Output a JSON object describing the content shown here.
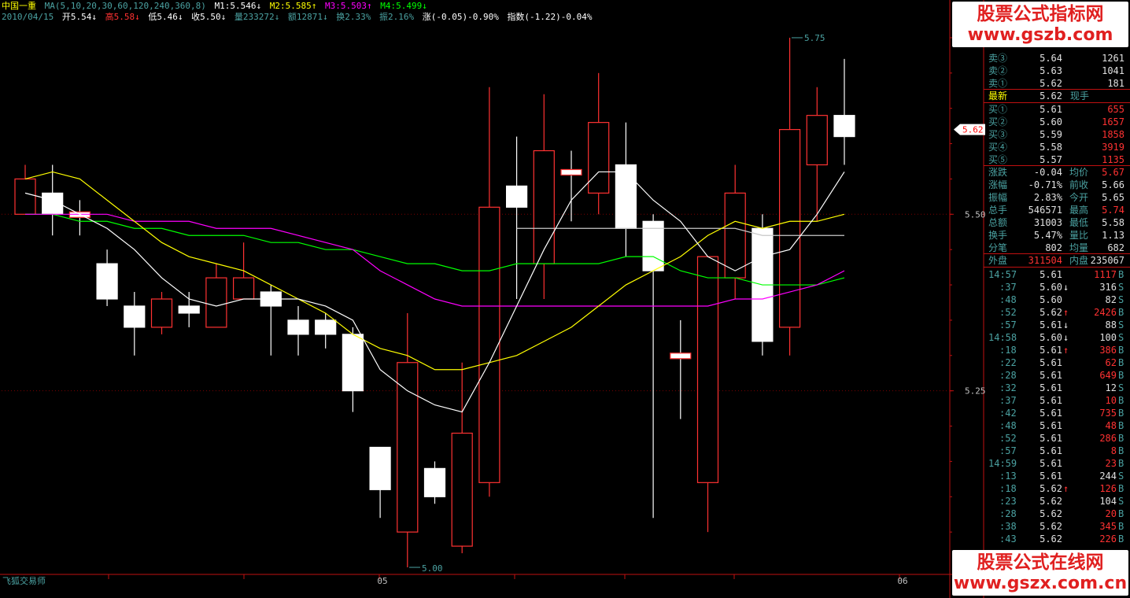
{
  "header": {
    "stock_name": "中国一重",
    "ma_label": "MA(5,10,20,30,60,120,240,360,8)",
    "m1": "M1:5.546↓",
    "m2": "M2:5.585↑",
    "m3": "M3:5.503↑",
    "m4": "M4:5.499↓",
    "date": "2010/04/15",
    "open": "开5.54↓",
    "high": "高5.58↓",
    "low": "低5.46↓",
    "close": "收5.50↓",
    "volume": "量233272↓",
    "amount": "额12871↓",
    "turnover": "换2.33%",
    "amplitude": "振2.16%",
    "change": "涨(-0.05)-0.90%",
    "index": "指数(-1.22)-0.04%"
  },
  "axis": {
    "price_labels": [
      "5.50",
      "5.25"
    ],
    "current_price_tag": "5.62",
    "max_label": "5.75",
    "min_label": "5.00",
    "month_labels": [
      "05",
      "06"
    ]
  },
  "colors": {
    "up": "#ff3232",
    "down": "#ffffff",
    "ma5": "#ffffff",
    "ma10": "#ffff00",
    "ma20": "#ff00ff",
    "ma30": "#00ff00",
    "ma60": "#c8c8c8",
    "axis": "#c01010",
    "label": "#4ba2a2"
  },
  "chart_data": {
    "type": "candlestick",
    "candles": [
      {
        "o": 5.5,
        "c": 5.55,
        "h": 5.57,
        "l": 5.5
      },
      {
        "o": 5.53,
        "c": 5.5,
        "h": 5.57,
        "l": 5.47
      },
      {
        "o": 5.5,
        "c": 5.5,
        "h": 5.52,
        "l": 5.47
      },
      {
        "o": 5.43,
        "c": 5.38,
        "h": 5.45,
        "l": 5.37
      },
      {
        "o": 5.37,
        "c": 5.34,
        "h": 5.39,
        "l": 5.3
      },
      {
        "o": 5.34,
        "c": 5.38,
        "h": 5.39,
        "l": 5.33
      },
      {
        "o": 5.37,
        "c": 5.36,
        "h": 5.39,
        "l": 5.34
      },
      {
        "o": 5.34,
        "c": 5.41,
        "h": 5.43,
        "l": 5.34
      },
      {
        "o": 5.38,
        "c": 5.41,
        "h": 5.46,
        "l": 5.38
      },
      {
        "o": 5.39,
        "c": 5.37,
        "h": 5.4,
        "l": 5.3
      },
      {
        "o": 5.35,
        "c": 5.33,
        "h": 5.37,
        "l": 5.3
      },
      {
        "o": 5.35,
        "c": 5.33,
        "h": 5.36,
        "l": 5.31
      },
      {
        "o": 5.33,
        "c": 5.25,
        "h": 5.34,
        "l": 5.22
      },
      {
        "o": 5.17,
        "c": 5.11,
        "h": 5.17,
        "l": 5.07
      },
      {
        "o": 5.05,
        "c": 5.29,
        "h": 5.36,
        "l": 5.0
      },
      {
        "o": 5.14,
        "c": 5.1,
        "h": 5.15,
        "l": 5.09
      },
      {
        "o": 5.03,
        "c": 5.19,
        "h": 5.29,
        "l": 5.02
      },
      {
        "o": 5.12,
        "c": 5.51,
        "h": 5.68,
        "l": 5.1
      },
      {
        "o": 5.54,
        "c": 5.51,
        "h": 5.61,
        "l": 5.38
      },
      {
        "o": 5.43,
        "c": 5.59,
        "h": 5.67,
        "l": 5.38
      },
      {
        "o": 5.56,
        "c": 5.56,
        "h": 5.59,
        "l": 5.49
      },
      {
        "o": 5.53,
        "c": 5.63,
        "h": 5.7,
        "l": 5.5
      },
      {
        "o": 5.57,
        "c": 5.48,
        "h": 5.63,
        "l": 5.44
      },
      {
        "o": 5.49,
        "c": 5.42,
        "h": 5.5,
        "l": 5.07
      },
      {
        "o": 5.3,
        "c": 5.3,
        "h": 5.35,
        "l": 5.21
      },
      {
        "o": 5.12,
        "c": 5.44,
        "h": 5.44,
        "l": 5.05
      },
      {
        "o": 5.41,
        "c": 5.53,
        "h": 5.57,
        "l": 5.38
      },
      {
        "o": 5.48,
        "c": 5.32,
        "h": 5.5,
        "l": 5.3
      },
      {
        "o": 5.34,
        "c": 5.62,
        "h": 5.75,
        "l": 5.3
      },
      {
        "o": 5.57,
        "c": 5.64,
        "h": 5.68,
        "l": 5.49
      },
      {
        "o": 5.64,
        "c": 5.61,
        "h": 5.72,
        "l": 5.57
      }
    ],
    "ma5": [
      5.53,
      5.52,
      5.5,
      5.48,
      5.45,
      5.41,
      5.38,
      5.37,
      5.38,
      5.38,
      5.38,
      5.37,
      5.35,
      5.28,
      5.25,
      5.23,
      5.22,
      5.29,
      5.37,
      5.45,
      5.52,
      5.56,
      5.56,
      5.52,
      5.49,
      5.44,
      5.42,
      5.44,
      5.45,
      5.5,
      5.56
    ],
    "ma10": [
      5.55,
      5.56,
      5.55,
      5.52,
      5.49,
      5.46,
      5.44,
      5.43,
      5.42,
      5.4,
      5.38,
      5.36,
      5.33,
      5.31,
      5.3,
      5.28,
      5.28,
      5.29,
      5.3,
      5.32,
      5.34,
      5.37,
      5.4,
      5.42,
      5.44,
      5.47,
      5.49,
      5.48,
      5.49,
      5.49,
      5.5
    ],
    "ma20": [
      5.5,
      5.5,
      5.5,
      5.5,
      5.49,
      5.49,
      5.49,
      5.48,
      5.48,
      5.48,
      5.47,
      5.46,
      5.45,
      5.42,
      5.4,
      5.38,
      5.37,
      5.37,
      5.37,
      5.37,
      5.37,
      5.37,
      5.37,
      5.37,
      5.37,
      5.37,
      5.38,
      5.38,
      5.39,
      5.4,
      5.42
    ],
    "ma30": [
      5.5,
      5.5,
      5.49,
      5.49,
      5.48,
      5.48,
      5.47,
      5.47,
      5.47,
      5.46,
      5.46,
      5.45,
      5.45,
      5.44,
      5.43,
      5.43,
      5.42,
      5.42,
      5.43,
      5.43,
      5.43,
      5.43,
      5.44,
      5.44,
      5.42,
      5.41,
      5.41,
      5.4,
      5.4,
      5.4,
      5.41
    ],
    "ma60": [
      null,
      null,
      null,
      null,
      null,
      null,
      null,
      null,
      null,
      null,
      null,
      null,
      null,
      null,
      null,
      null,
      null,
      null,
      5.48,
      5.48,
      5.48,
      5.48,
      5.48,
      5.48,
      5.48,
      5.48,
      5.48,
      5.47,
      5.47,
      5.47,
      5.47
    ],
    "ylim": [
      4.99,
      5.77
    ]
  },
  "quote": {
    "asks": [
      {
        "label": "卖③",
        "price": "5.64",
        "vol": "1261"
      },
      {
        "label": "卖②",
        "price": "5.63",
        "vol": "1041"
      },
      {
        "label": "卖①",
        "price": "5.62",
        "vol": "181"
      }
    ],
    "latest_label": "最新",
    "latest_price": "5.62",
    "latest_tag": "现手",
    "bids": [
      {
        "label": "买①",
        "price": "5.61",
        "vol": "655"
      },
      {
        "label": "买②",
        "price": "5.60",
        "vol": "1657"
      },
      {
        "label": "买③",
        "price": "5.59",
        "vol": "1858"
      },
      {
        "label": "买④",
        "price": "5.58",
        "vol": "3919"
      },
      {
        "label": "买⑤",
        "price": "5.57",
        "vol": "1135"
      }
    ],
    "stats": [
      {
        "k1": "涨跌",
        "v1": "-0.04",
        "k2": "均价",
        "v2": "5.67",
        "c2": "#ff3232"
      },
      {
        "k1": "涨幅",
        "v1": "-0.71%",
        "k2": "前收",
        "v2": "5.66",
        "c2": "#e0e0e0"
      },
      {
        "k1": "振幅",
        "v1": "2.83%",
        "k2": "今开",
        "v2": "5.65",
        "c2": "#e0e0e0"
      },
      {
        "k1": "总手",
        "v1": "546571",
        "k2": "最高",
        "v2": "5.74",
        "c2": "#ff3232"
      },
      {
        "k1": "总额",
        "v1": "31003",
        "k2": "最低",
        "v2": "5.58",
        "c2": "#e0e0e0"
      },
      {
        "k1": "换手",
        "v1": "5.47%",
        "k2": "量比",
        "v2": "1.13",
        "c2": "#e0e0e0"
      },
      {
        "k1": "分笔",
        "v1": "802",
        "k2": "均量",
        "v2": "682",
        "c2": "#e0e0e0"
      }
    ],
    "outer_label": "外盘",
    "outer_val": "311504",
    "inner_label": "内盘",
    "inner_val": "235067"
  },
  "ticks": [
    {
      "t": "14:57",
      "p": "5.61",
      "a": "",
      "v": "1117",
      "vc": "#ff3232",
      "s": "B"
    },
    {
      "t": ":37",
      "p": "5.60",
      "a": "↓",
      "v": "316",
      "vc": "#e0e0e0",
      "s": "S"
    },
    {
      "t": ":48",
      "p": "5.60",
      "a": "",
      "v": "82",
      "vc": "#e0e0e0",
      "s": "S"
    },
    {
      "t": ":52",
      "p": "5.62",
      "a": "↑",
      "v": "2426",
      "vc": "#ff3232",
      "s": "B"
    },
    {
      "t": ":57",
      "p": "5.61",
      "a": "↓",
      "v": "88",
      "vc": "#e0e0e0",
      "s": "S"
    },
    {
      "t": "14:58",
      "p": "5.60",
      "a": "↓",
      "v": "100",
      "vc": "#e0e0e0",
      "s": "S"
    },
    {
      "t": ":18",
      "p": "5.61",
      "a": "↑",
      "v": "386",
      "vc": "#ff3232",
      "s": "B"
    },
    {
      "t": ":22",
      "p": "5.61",
      "a": "",
      "v": "62",
      "vc": "#ff3232",
      "s": "B"
    },
    {
      "t": ":28",
      "p": "5.61",
      "a": "",
      "v": "649",
      "vc": "#ff3232",
      "s": "B"
    },
    {
      "t": ":32",
      "p": "5.61",
      "a": "",
      "v": "12",
      "vc": "#e0e0e0",
      "s": "S"
    },
    {
      "t": ":37",
      "p": "5.61",
      "a": "",
      "v": "10",
      "vc": "#ff3232",
      "s": "B"
    },
    {
      "t": ":42",
      "p": "5.61",
      "a": "",
      "v": "735",
      "vc": "#ff3232",
      "s": "B"
    },
    {
      "t": ":48",
      "p": "5.61",
      "a": "",
      "v": "48",
      "vc": "#ff3232",
      "s": "B"
    },
    {
      "t": ":52",
      "p": "5.61",
      "a": "",
      "v": "286",
      "vc": "#ff3232",
      "s": "B"
    },
    {
      "t": ":57",
      "p": "5.61",
      "a": "",
      "v": "8",
      "vc": "#ff3232",
      "s": "B"
    },
    {
      "t": "14:59",
      "p": "5.61",
      "a": "",
      "v": "23",
      "vc": "#ff3232",
      "s": "B"
    },
    {
      "t": ":13",
      "p": "5.61",
      "a": "",
      "v": "244",
      "vc": "#e0e0e0",
      "s": "S"
    },
    {
      "t": ":18",
      "p": "5.62",
      "a": "↑",
      "v": "126",
      "vc": "#ff3232",
      "s": "B"
    },
    {
      "t": ":23",
      "p": "5.62",
      "a": "",
      "v": "104",
      "vc": "#e0e0e0",
      "s": "S"
    },
    {
      "t": ":28",
      "p": "5.62",
      "a": "",
      "v": "20",
      "vc": "#ff3232",
      "s": "B"
    },
    {
      "t": ":38",
      "p": "5.62",
      "a": "",
      "v": "345",
      "vc": "#ff3232",
      "s": "B"
    },
    {
      "t": ":43",
      "p": "5.62",
      "a": "",
      "v": "226",
      "vc": "#ff3232",
      "s": "B"
    }
  ],
  "watermark": {
    "top_title": "股票公式指标网",
    "top_url": "www.gszb.com",
    "bottom_title": "股票公式在线网",
    "bottom_url": "www.gszx.com.cn"
  },
  "footer": {
    "app_name": "飞狐交易师"
  }
}
